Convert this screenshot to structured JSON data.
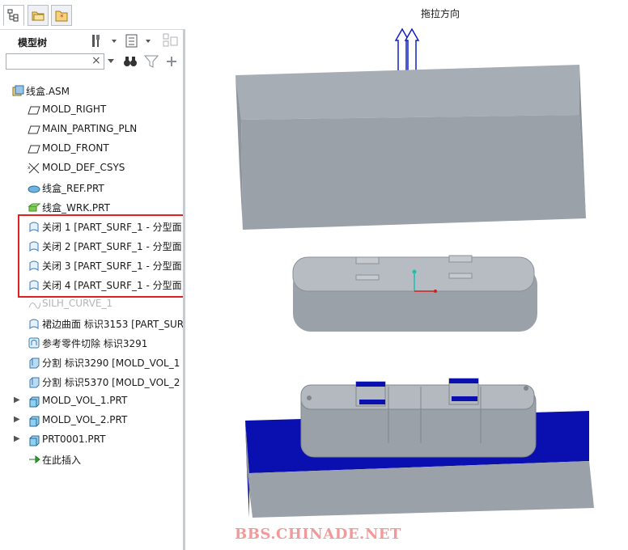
{
  "sidebar": {
    "tree_title": "模型树",
    "search": {
      "value": "",
      "placeholder": ""
    },
    "tabs": [
      {
        "name": "model-tree",
        "active": true
      },
      {
        "name": "folder-browser",
        "active": false
      },
      {
        "name": "favorites",
        "active": false
      }
    ],
    "items": [
      {
        "label": "线盒.ASM",
        "icon": "assembly-icon",
        "expandable": false
      },
      {
        "label": "MOLD_RIGHT",
        "icon": "datum-plane-icon",
        "expandable": false
      },
      {
        "label": "MAIN_PARTING_PLN",
        "icon": "datum-plane-icon",
        "expandable": false
      },
      {
        "label": "MOLD_FRONT",
        "icon": "datum-plane-icon",
        "expandable": false
      },
      {
        "label": "MOLD_DEF_CSYS",
        "icon": "coordinate-system-icon",
        "expandable": false
      },
      {
        "label": "线盒_REF.PRT",
        "icon": "reference-part-icon",
        "expandable": false
      },
      {
        "label": "线盒_WRK.PRT",
        "icon": "workpiece-icon",
        "expandable": false
      },
      {
        "label": "关闭 1 [PART_SURF_1 - 分型面]",
        "icon": "surface-icon",
        "expandable": false
      },
      {
        "label": "关闭 2 [PART_SURF_1 - 分型面]",
        "icon": "surface-icon",
        "expandable": false
      },
      {
        "label": "关闭 3 [PART_SURF_1 - 分型面]",
        "icon": "surface-icon",
        "expandable": false
      },
      {
        "label": "关闭 4 [PART_SURF_1 - 分型面]",
        "icon": "surface-icon",
        "expandable": false
      },
      {
        "label": "SILH_CURVE_1",
        "icon": "curve-icon",
        "expandable": false,
        "dim": true
      },
      {
        "label": "裙边曲面 标识3153 [PART_SUR",
        "icon": "surface-icon",
        "expandable": false
      },
      {
        "label": "参考零件切除 标识3291",
        "icon": "ref-cut-icon",
        "expandable": false
      },
      {
        "label": "分割 标识3290 [MOLD_VOL_1 -",
        "icon": "split-icon",
        "expandable": false
      },
      {
        "label": "分割 标识5370 [MOLD_VOL_2 -",
        "icon": "split-icon",
        "expandable": false
      },
      {
        "label": "MOLD_VOL_1.PRT",
        "icon": "part-icon",
        "expandable": true
      },
      {
        "label": "MOLD_VOL_2.PRT",
        "icon": "part-icon",
        "expandable": true
      },
      {
        "label": "PRT0001.PRT",
        "icon": "part-icon",
        "expandable": true
      },
      {
        "label": "在此插入",
        "icon": "insert-here-icon",
        "expandable": false
      }
    ]
  },
  "viewport": {
    "pull_direction_label": "拖拉方向",
    "watermark": "BBS.CHINADE.NET",
    "colors": {
      "mold_gray": "#9aa1a8",
      "parting_blue": "#0a10b0",
      "highlight_red": "#e02020"
    }
  }
}
